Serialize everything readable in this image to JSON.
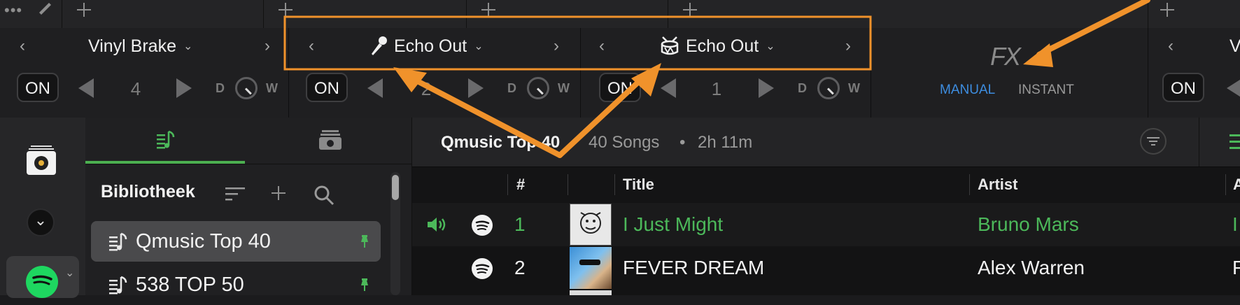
{
  "fx_units": [
    {
      "name": "Vinyl Brake",
      "on_label": "ON",
      "value": "4",
      "dry": "D",
      "wet": "W",
      "icon": "none"
    },
    {
      "name": "Echo Out",
      "on_label": "ON",
      "value": "2",
      "dry": "D",
      "wet": "W",
      "icon": "microphone-icon"
    },
    {
      "name": "Echo Out",
      "on_label": "ON",
      "value": "1",
      "dry": "D",
      "wet": "W",
      "icon": "drum-icon"
    }
  ],
  "fx_panel": {
    "logo": "FX",
    "modes": [
      "MANUAL",
      "INSTANT"
    ],
    "active_mode": "MANUAL",
    "accent": "#3d8de0"
  },
  "right_unit": {
    "name_partial": "V",
    "on_label": "ON"
  },
  "library": {
    "title": "Bibliotheek",
    "items": [
      {
        "label": "Qmusic Top 40",
        "selected": true
      },
      {
        "label": "538 TOP 50",
        "selected": false
      }
    ]
  },
  "playlist": {
    "title": "Qmusic Top 40",
    "count": "40 Songs",
    "separator": "•",
    "duration": "2h 11m"
  },
  "columns": {
    "num": "#",
    "title": "Title",
    "artist": "Artist",
    "extra": "A"
  },
  "tracks": [
    {
      "num": "1",
      "title": "I Just Might",
      "artist": "Bruno Mars",
      "extra": "I",
      "playing": true
    },
    {
      "num": "2",
      "title": "FEVER DREAM",
      "artist": "Alex Warren",
      "extra": "F",
      "playing": false
    }
  ],
  "colors": {
    "green": "#4cb85a",
    "orange": "#f0922b",
    "blue": "#3d8de0"
  }
}
